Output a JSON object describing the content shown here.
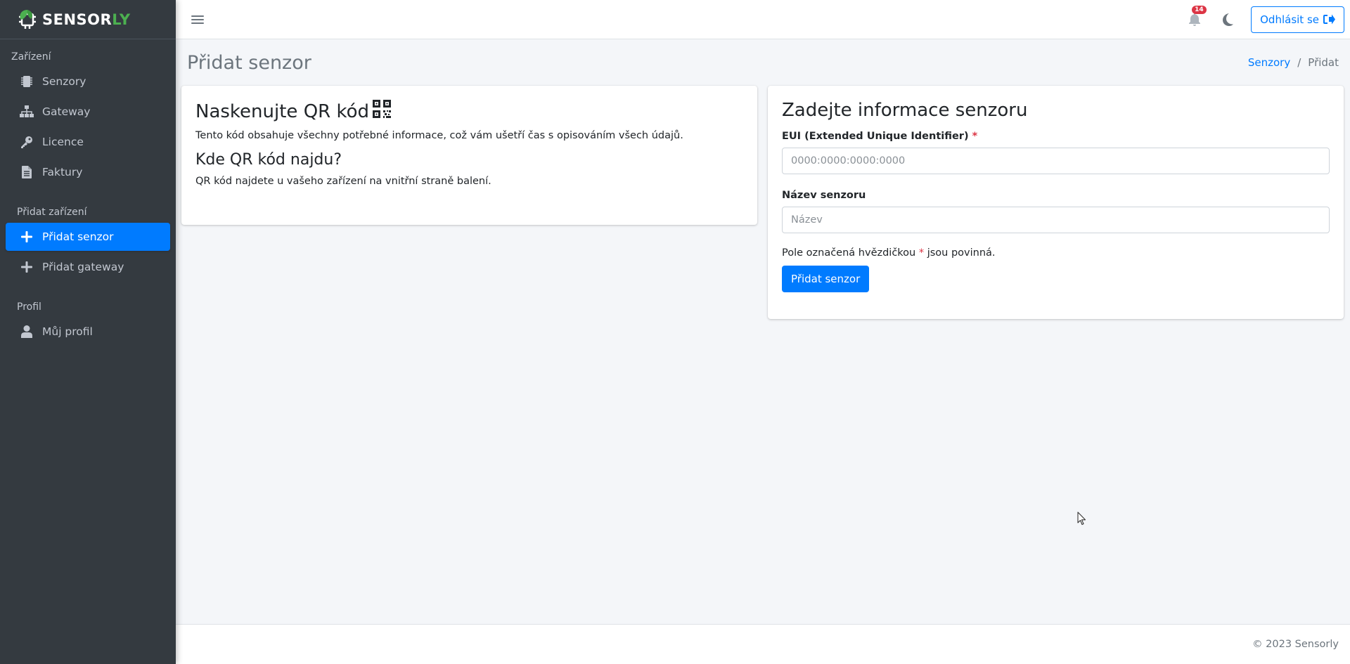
{
  "brand": {
    "name_main": "SENSOR",
    "name_accent": "LY",
    "accent_color": "#4cb050"
  },
  "sidebar": {
    "sections": [
      {
        "header": "Zařízení",
        "items": [
          {
            "label": "Senzory",
            "icon": "chip-icon"
          },
          {
            "label": "Gateway",
            "icon": "network-icon"
          },
          {
            "label": "Licence",
            "icon": "key-icon"
          },
          {
            "label": "Faktury",
            "icon": "invoice-icon"
          }
        ]
      },
      {
        "header": "Přidat zařízení",
        "items": [
          {
            "label": "Přidat senzor",
            "icon": "plus-icon",
            "active": true
          },
          {
            "label": "Přidat gateway",
            "icon": "plus-icon"
          }
        ]
      },
      {
        "header": "Profil",
        "items": [
          {
            "label": "Můj profil",
            "icon": "user-icon"
          }
        ]
      }
    ]
  },
  "topbar": {
    "notifications_count": "14",
    "logout_label": "Odhlásit se"
  },
  "page": {
    "title": "Přidat senzor",
    "breadcrumb": {
      "link": "Senzory",
      "separator": "/",
      "current": "Přidat"
    }
  },
  "qr_card": {
    "title": "Naskenujte QR kód",
    "description": "Tento kód obsahuje všechny potřebné informace, což vám ušetří čas s opisováním všech údajů.",
    "subtitle": "Kde QR kód najdu?",
    "subtext": "QR kód najdete u vašeho zařízení na vnitřní straně balení."
  },
  "form_card": {
    "title": "Zadejte informace senzoru",
    "eui_label": "EUI (Extended Unique Identifier)",
    "eui_required_mark": "*",
    "eui_placeholder": "0000:0000:0000:0000",
    "eui_value": "",
    "name_label": "Název senzoru",
    "name_placeholder": "Název",
    "name_value": "",
    "hint_before": "Pole označená hvězdičkou",
    "hint_mark": "*",
    "hint_after": "jsou povinná.",
    "submit_label": "Přidat senzor"
  },
  "footer": {
    "copyright": "© 2023 Sensorly"
  },
  "colors": {
    "primary": "#007bff",
    "sidebar_bg": "#343a40",
    "danger": "#dc3545"
  }
}
